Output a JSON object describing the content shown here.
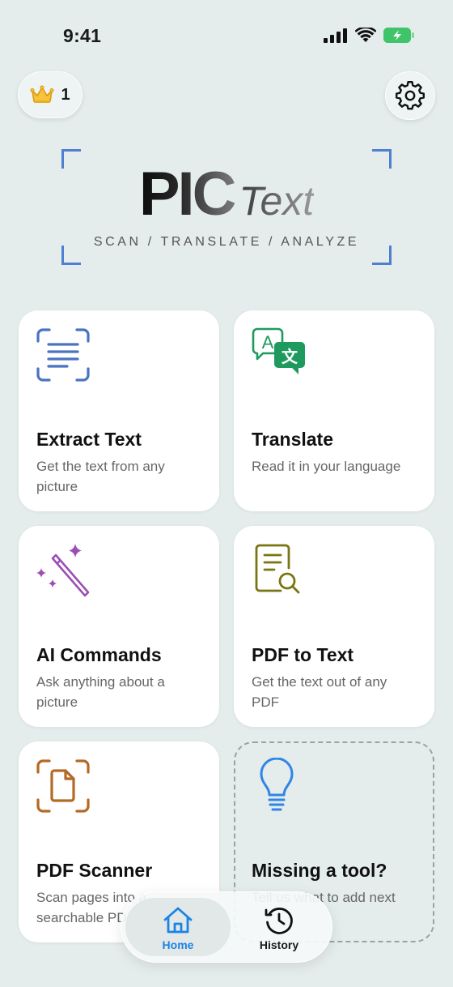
{
  "status": {
    "time": "9:41"
  },
  "header": {
    "crown_count": "1"
  },
  "logo": {
    "pic": "PIC",
    "text": "Text",
    "tagline": "SCAN / TRANSLATE / ANALYZE"
  },
  "cards": [
    {
      "title": "Extract Text",
      "subtitle": "Get the text from any picture",
      "icon": "scan-text-icon",
      "color": "#4a73c0"
    },
    {
      "title": "Translate",
      "subtitle": "Read it in your language",
      "icon": "translate-icon",
      "color": "#1e9a5e"
    },
    {
      "title": "AI Commands",
      "subtitle": "Ask anything about a picture",
      "icon": "magic-wand-icon",
      "color": "#9b4fb5"
    },
    {
      "title": "PDF to Text",
      "subtitle": "Get the text out of any PDF",
      "icon": "document-search-icon",
      "color": "#7a7512"
    },
    {
      "title": "PDF Scanner",
      "subtitle": "Scan pages into a searchable PDF",
      "icon": "scan-document-icon",
      "color": "#b36a24"
    },
    {
      "title": "Missing a tool?",
      "subtitle": "Tell us what to add next",
      "icon": "lightbulb-icon",
      "color": "#2f86e6"
    }
  ],
  "tabs": [
    {
      "label": "Home",
      "icon": "house-icon",
      "active": true,
      "color": "#1a84e6"
    },
    {
      "label": "History",
      "icon": "history-icon",
      "active": false
    }
  ]
}
